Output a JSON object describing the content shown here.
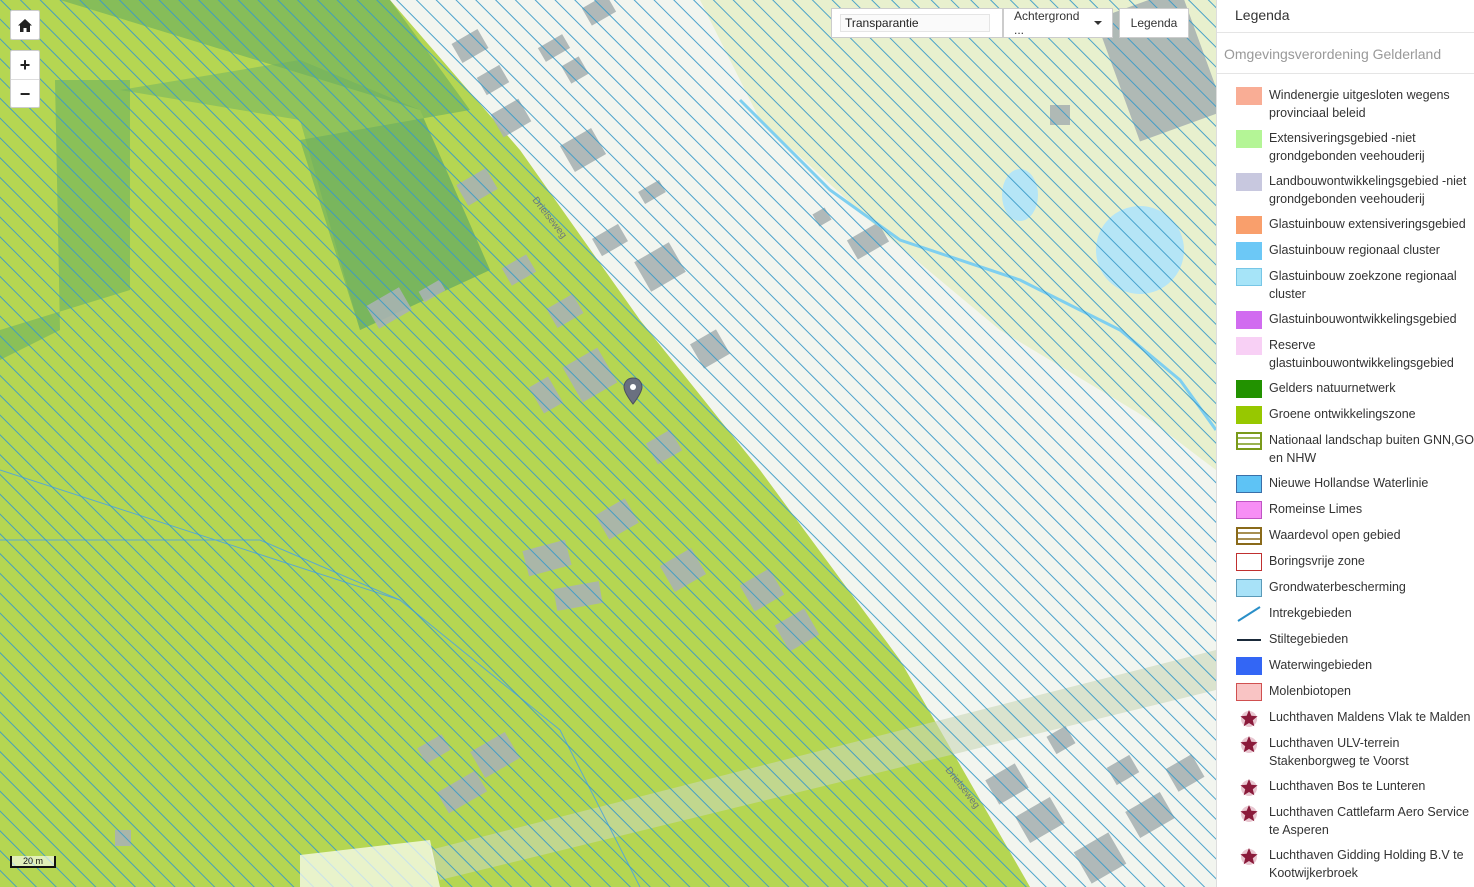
{
  "map": {
    "home_icon": "home-icon",
    "zoom_in_label": "+",
    "zoom_out_label": "−",
    "street_label_1": "Drielseweg",
    "street_label_2": "Drielseweg",
    "scale_label": "20 m",
    "marker_icon": "map-marker-icon"
  },
  "toolbar": {
    "transparency_value": "Transparantie",
    "background_label": "Achtergrond ...",
    "legend_button_label": "Legenda"
  },
  "panel": {
    "title": "Legenda",
    "subtitle": "Omgevingsverordening Gelderland"
  },
  "legend": [
    {
      "label": "Windenergie uitgesloten wegens provinciaal beleid",
      "kind": "fill",
      "fill": "#f9ad95",
      "stroke": "#f9ad95"
    },
    {
      "label": "Extensiveringsgebied -niet grondgebonden veehouderij",
      "kind": "fill",
      "fill": "#b4f596",
      "stroke": "#b4f596"
    },
    {
      "label": "Landbouwontwikkelingsgebied -niet grondgebonden veehouderij",
      "kind": "fill",
      "fill": "#c8c8df",
      "stroke": "#c8c8df"
    },
    {
      "label": "Glastuinbouw extensiveringsgebied",
      "kind": "fill",
      "fill": "#f99f6c",
      "stroke": "#f99f6c"
    },
    {
      "label": "Glastuinbouw regionaal cluster",
      "kind": "fill",
      "fill": "#6cc8f6",
      "stroke": "#6cc8f6"
    },
    {
      "label": "Glastuinbouw zoekzone regionaal cluster",
      "kind": "fill",
      "fill": "#a6e4f8",
      "stroke": "#77c6e6"
    },
    {
      "label": "Glastuinbouwontwikkelingsgebied",
      "kind": "fill",
      "fill": "#d16cf0",
      "stroke": "#d16cf0"
    },
    {
      "label": "Reserve glastuinbouwontwikkelingsgebied",
      "kind": "fill",
      "fill": "#f8d0f5",
      "stroke": "#f8d0f5"
    },
    {
      "label": "Gelders natuurnetwerk",
      "kind": "fill",
      "fill": "#229200",
      "stroke": "#229200"
    },
    {
      "label": "Groene ontwikkelingszone",
      "kind": "fill",
      "fill": "#97c800",
      "stroke": "#97c800"
    },
    {
      "label": "Nationaal landschap buiten GNN,GO en NHW",
      "kind": "hlines",
      "fill": "#ffffff",
      "stroke": "#7a9a1a"
    },
    {
      "label": "Nieuwe Hollandse Waterlinie",
      "kind": "fill",
      "fill": "#5ec3f5",
      "stroke": "#3a6fa8"
    },
    {
      "label": "Romeinse Limes",
      "kind": "fill",
      "fill": "#f78ef5",
      "stroke": "#c054c4"
    },
    {
      "label": "Waardevol open gebied",
      "kind": "hlines",
      "fill": "#ffffff",
      "stroke": "#8a6a1a"
    },
    {
      "label": "Boringsvrije zone",
      "kind": "fill",
      "fill": "#ffffff",
      "stroke": "#c03030"
    },
    {
      "label": "Grondwaterbescherming",
      "kind": "fill",
      "fill": "#a8e2f8",
      "stroke": "#5a9ab8"
    },
    {
      "label": "Intrekgebieden",
      "kind": "diag",
      "fill": "#ffffff",
      "stroke": "#2a8fc8"
    },
    {
      "label": "Stiltegebieden",
      "kind": "hline",
      "fill": "#ffffff",
      "stroke": "#1a2a3a"
    },
    {
      "label": "Waterwingebieden",
      "kind": "fill",
      "fill": "#3366f5",
      "stroke": "#3366f5"
    },
    {
      "label": "Molenbiotopen",
      "kind": "fill",
      "fill": "#f9c4c4",
      "stroke": "#d05050"
    },
    {
      "label": "Luchthaven Maldens Vlak te Malden",
      "kind": "star",
      "fill": "#8a1a3a",
      "stroke": "#8a1a3a"
    },
    {
      "label": "Luchthaven ULV-terrein Stakenborgweg te Voorst",
      "kind": "star",
      "fill": "#8a1a3a",
      "stroke": "#8a1a3a"
    },
    {
      "label": "Luchthaven Bos te Lunteren",
      "kind": "star",
      "fill": "#8a1a3a",
      "stroke": "#8a1a3a"
    },
    {
      "label": "Luchthaven Cattlefarm Aero Service te Asperen",
      "kind": "star",
      "fill": "#8a1a3a",
      "stroke": "#8a1a3a"
    },
    {
      "label": "Luchthaven Gidding Holding B.V te Kootwijkerbroek",
      "kind": "star",
      "fill": "#8a1a3a",
      "stroke": "#8a1a3a"
    }
  ]
}
